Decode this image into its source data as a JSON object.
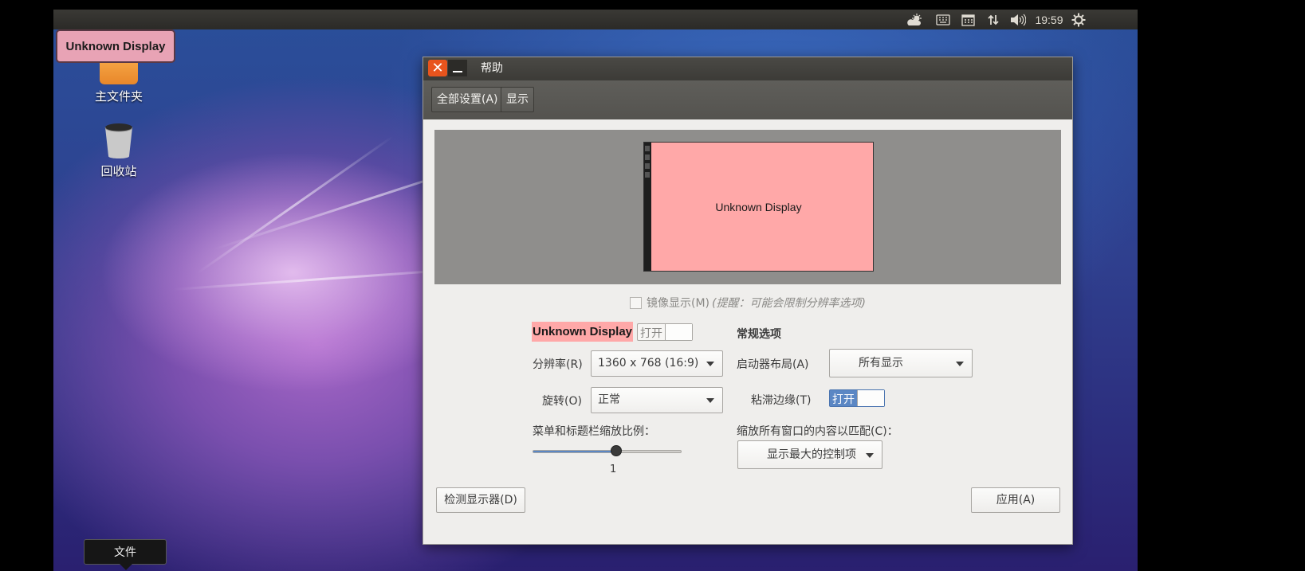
{
  "top_panel": {
    "icons": [
      "cloud-sun-icon",
      "keyboard-icon",
      "calendar-icon",
      "network-transfer-icon",
      "volume-icon",
      "settings-gear-icon"
    ],
    "clock": "19:59"
  },
  "desktop": {
    "notification": "Unknown Display",
    "icons": [
      {
        "label": "主文件夹",
        "icon": "home-folder-icon"
      },
      {
        "label": "回收站",
        "icon": "trash-icon"
      }
    ],
    "tooltip": "文件"
  },
  "window": {
    "title": "帮助",
    "toolbar": {
      "all_settings": "全部设置(A)",
      "display": "显示"
    },
    "preview": {
      "monitor_label": "Unknown Display",
      "monitor_color": "#ffa8a8"
    },
    "mirror": {
      "label": "镜像显示(M)",
      "hint": "(提醒：可能会限制分辨率选项)",
      "checked": false
    },
    "display_name": "Unknown Display",
    "display_toggle": {
      "label": "打开",
      "on": false
    },
    "resolution": {
      "label": "分辨率(R)",
      "value": "1360 x 768 (16:9)"
    },
    "rotation": {
      "label": "旋转(O)",
      "value": "正常"
    },
    "scale": {
      "label": "菜单和标题栏缩放比例：",
      "value": "1"
    },
    "general": {
      "heading": "常规选项",
      "launcher_placement": {
        "label": "启动器布局(A)",
        "value": "所有显示"
      },
      "sticky_edges": {
        "label": "粘滞边缘(T)",
        "toggle_label": "打开",
        "on": true
      },
      "scale_windows": {
        "label": "缩放所有窗口的内容以匹配(C)：",
        "value": "显示最大的控制项"
      }
    },
    "detect_button": "检测显示器(D)",
    "apply_button": "应用(A)"
  }
}
